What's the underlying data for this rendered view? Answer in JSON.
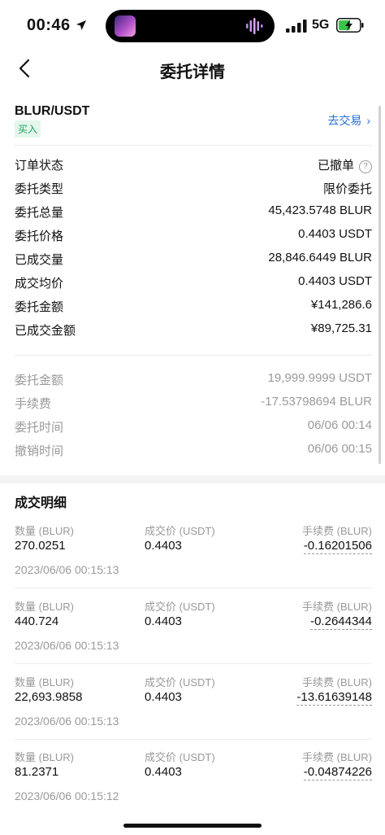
{
  "status_bar": {
    "time": "00:46",
    "network": "5G",
    "location_icon": "location-arrow-icon",
    "signal_icon": "signal-icon",
    "battery_icon": "battery-charging-icon"
  },
  "nav": {
    "title": "委托详情",
    "back_icon": "chevron-left-icon"
  },
  "pair": {
    "symbol": "BLUR/USDT",
    "side": "买入",
    "trade_link": "去交易",
    "trade_chevron": "›",
    "side_color": "#19a55b",
    "link_color": "#2b6fd6"
  },
  "order_info": [
    {
      "label": "订单状态",
      "value": "已撤单"
    },
    {
      "label": "委托类型",
      "value": "限价委托"
    },
    {
      "label": "委托总量",
      "value": "45,423.5748 BLUR"
    },
    {
      "label": "委托价格",
      "value": "0.4403 USDT"
    },
    {
      "label": "已成交量",
      "value": "28,846.6449 BLUR"
    },
    {
      "label": "成交均价",
      "value": "0.4403 USDT"
    },
    {
      "label": "委托金额",
      "value": "¥141,286.6"
    },
    {
      "label": "已成交金额",
      "value": "¥89,725.31"
    }
  ],
  "extra_info": [
    {
      "label": "委托金额",
      "value": "19,999.9999 USDT"
    },
    {
      "label": "手续费",
      "value": "-17.53798694 BLUR"
    },
    {
      "label": "委托时间",
      "value": "06/06 00:14"
    },
    {
      "label": "撤销时间",
      "value": "06/06 00:15"
    }
  ],
  "fills_section": {
    "title": "成交明细",
    "col_qty": "数量 (BLUR)",
    "col_price": "成交价 (USDT)",
    "col_fee": "手续费 (BLUR)",
    "rows": [
      {
        "qty": "270.0251",
        "price": "0.4403",
        "fee": "-0.16201506",
        "time": "2023/06/06 00:15:13"
      },
      {
        "qty": "440.724",
        "price": "0.4403",
        "fee": "-0.2644344",
        "time": "2023/06/06 00:15:13"
      },
      {
        "qty": "22,693.9858",
        "price": "0.4403",
        "fee": "-13.61639148",
        "time": "2023/06/06 00:15:13"
      },
      {
        "qty": "81.2371",
        "price": "0.4403",
        "fee": "-0.04874226",
        "time": "2023/06/06 00:15:12"
      }
    ]
  }
}
